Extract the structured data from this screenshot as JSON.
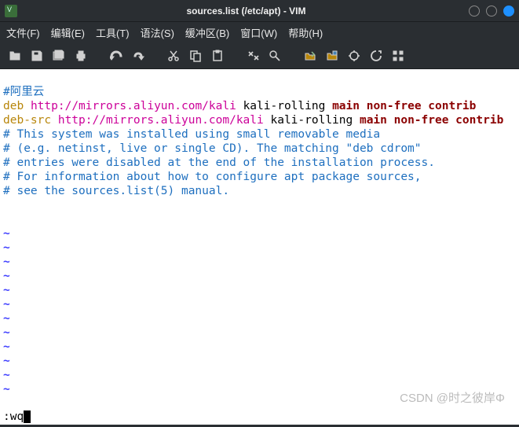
{
  "window": {
    "title": "sources.list (/etc/apt) - VIM"
  },
  "menu": {
    "file": "文件(F)",
    "edit": "编辑(E)",
    "tools": "工具(T)",
    "syntax": "语法(S)",
    "buffers": "缓冲区(B)",
    "window": "窗口(W)",
    "help": "帮助(H)"
  },
  "file": {
    "line1_comment": "#阿里云",
    "line2_deb": "deb",
    "line2_url": "http://mirrors.aliyun.com/kali",
    "line2_dist": " kali-rolling ",
    "line2_comp": "main non-free contrib",
    "line3_debsrc": "deb-src",
    "line3_url": "http://mirrors.aliyun.com/kali",
    "line3_dist": " kali-rolling ",
    "line3_comp": "main non-free contrib",
    "line4": "# This system was installed using small removable media",
    "line5": "# (e.g. netinst, live or single CD). The matching \"deb cdrom\"",
    "line6": "# entries were disabled at the end of the installation process.",
    "line7": "# For information about how to configure apt package sources,",
    "line8": "# see the sources.list(5) manual."
  },
  "tildes": [
    "~",
    "~",
    "~",
    "~",
    "~",
    "~",
    "~",
    "~",
    "~",
    "~",
    "~",
    "~"
  ],
  "cmdline": ":wq",
  "watermark": "CSDN @时之彼岸Φ"
}
